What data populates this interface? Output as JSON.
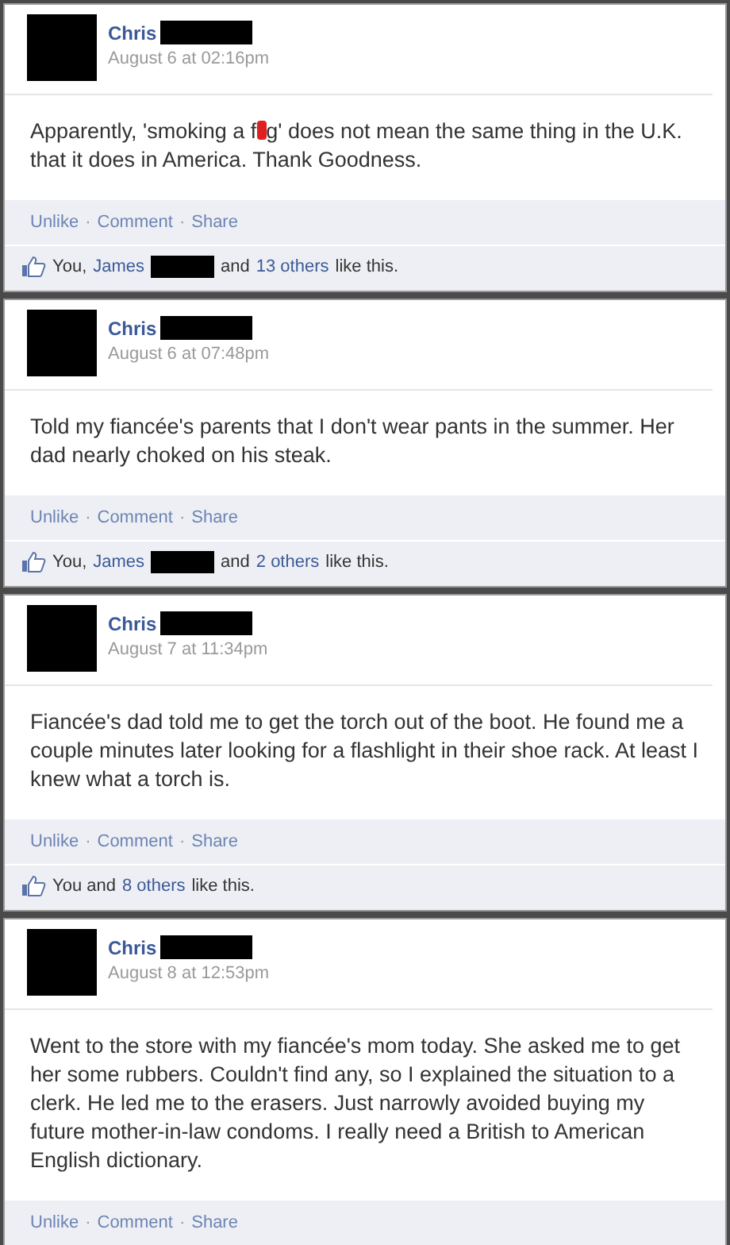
{
  "posts": [
    {
      "author": "Chris",
      "time": "August 6 at 02:16pm",
      "body": [
        {
          "kind": "text",
          "text": "Apparently, 'smoking a f"
        },
        {
          "kind": "censor",
          "color": "#e02020"
        },
        {
          "kind": "text",
          "text": "g' does not mean the same thing in the U.K. that it does in America. Thank Goodness."
        }
      ],
      "actions": [
        "Unlike",
        "Comment",
        "Share"
      ],
      "likes": [
        {
          "kind": "text",
          "text": "You,"
        },
        {
          "kind": "link",
          "text": "James"
        },
        {
          "kind": "redacted"
        },
        {
          "kind": "text",
          "text": "and"
        },
        {
          "kind": "link",
          "text": "13 others"
        },
        {
          "kind": "text",
          "text": "like this."
        }
      ]
    },
    {
      "author": "Chris",
      "time": "August 6 at 07:48pm",
      "body": [
        {
          "kind": "text",
          "text": "Told my fiancée's parents that I don't wear pants in the summer. Her dad nearly choked on his steak."
        }
      ],
      "actions": [
        "Unlike",
        "Comment",
        "Share"
      ],
      "likes": [
        {
          "kind": "text",
          "text": "You,"
        },
        {
          "kind": "link",
          "text": "James"
        },
        {
          "kind": "redacted"
        },
        {
          "kind": "text",
          "text": "and"
        },
        {
          "kind": "link",
          "text": "2 others"
        },
        {
          "kind": "text",
          "text": "like this."
        }
      ]
    },
    {
      "author": "Chris",
      "time": "August 7 at 11:34pm",
      "body": [
        {
          "kind": "text",
          "text": "Fiancée's dad told me to get the torch out of the boot. He found me a couple minutes later looking for a flashlight in their shoe rack. At least I knew what a torch is."
        }
      ],
      "actions": [
        "Unlike",
        "Comment",
        "Share"
      ],
      "likes": [
        {
          "kind": "text",
          "text": "You and"
        },
        {
          "kind": "link",
          "text": "8 others"
        },
        {
          "kind": "text",
          "text": "like this."
        }
      ]
    },
    {
      "author": "Chris",
      "time": "August 8 at 12:53pm",
      "body": [
        {
          "kind": "text",
          "text": "Went to the store with my fiancée's mom today. She asked me to get her some rubbers. Couldn't find any, so I explained the situation to a clerk. He led me to the erasers. Just narrowly avoided buying my future mother-in-law condoms. I really need a British to American English dictionary."
        }
      ],
      "actions": [
        "Unlike",
        "Comment",
        "Share"
      ]
    }
  ],
  "action_separator": "·"
}
